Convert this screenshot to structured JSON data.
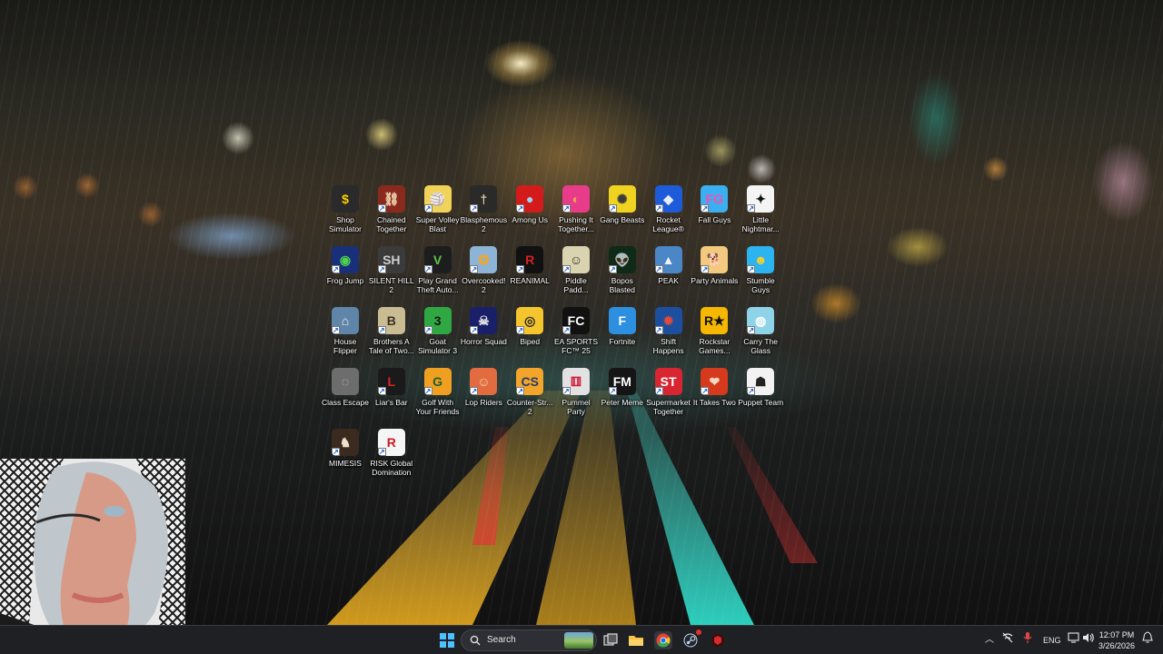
{
  "desktop": {
    "icons": [
      {
        "label": "Shop Simulator",
        "glyph": "$",
        "bg": "#2a2a2a",
        "fg": "#ffd000",
        "shortcut": false
      },
      {
        "label": "Chained Together",
        "glyph": "⛓",
        "bg": "#8a2a1f",
        "fg": "#f1d6b0",
        "shortcut": true
      },
      {
        "label": "Super Volley Blast",
        "glyph": "🏐",
        "bg": "#f2d35a",
        "fg": "#2a5fbf",
        "shortcut": true
      },
      {
        "label": "Blasphemous 2",
        "glyph": "†",
        "bg": "#2a2a28",
        "fg": "#d8cfa6",
        "shortcut": true
      },
      {
        "label": "Among Us",
        "glyph": "●",
        "bg": "#d31b1b",
        "fg": "#9ad5f5",
        "shortcut": true
      },
      {
        "label": "Pushing It Together...",
        "glyph": "◐",
        "bg": "#e83c8a",
        "fg": "#f6a24a",
        "shortcut": true
      },
      {
        "label": "Gang Beasts",
        "glyph": "✺",
        "bg": "#f0d320",
        "fg": "#3a3a3a",
        "shortcut": true
      },
      {
        "label": "Rocket League®",
        "glyph": "◆",
        "bg": "#1e5bd8",
        "fg": "#e8eef8",
        "shortcut": true
      },
      {
        "label": "Fall Guys",
        "glyph": "FG",
        "bg": "#3ab0f0",
        "fg": "#ff4ab0",
        "shortcut": true
      },
      {
        "label": "Little Nightmar...",
        "glyph": "✦",
        "bg": "#f4f4f4",
        "fg": "#111111",
        "shortcut": true
      },
      {
        "label": "Frog Jump",
        "glyph": "◉",
        "bg": "#1a2f7a",
        "fg": "#4cd34c",
        "shortcut": true
      },
      {
        "label": "SILENT HILL 2",
        "glyph": "SH",
        "bg": "#3b3b3b",
        "fg": "#cfcfcf",
        "shortcut": true
      },
      {
        "label": "Play Grand Theft Auto...",
        "glyph": "V",
        "bg": "#1d1d1d",
        "fg": "#5fc24b",
        "shortcut": true
      },
      {
        "label": "Overcooked! 2",
        "glyph": "✪",
        "bg": "#8db3d6",
        "fg": "#f5a623",
        "shortcut": true
      },
      {
        "label": "REANIMAL",
        "glyph": "R",
        "bg": "#111111",
        "fg": "#d82020",
        "shortcut": true
      },
      {
        "label": "Piddle Padd...",
        "glyph": "☺",
        "bg": "#d9d3b0",
        "fg": "#3a2f22",
        "shortcut": true
      },
      {
        "label": "Bopos Blasted",
        "glyph": "👽",
        "bg": "#0f2a17",
        "fg": "#56d24a",
        "shortcut": true
      },
      {
        "label": "PEAK",
        "glyph": "▲",
        "bg": "#4b86c6",
        "fg": "#f1f1f1",
        "shortcut": true
      },
      {
        "label": "Party Animals",
        "glyph": "🐕",
        "bg": "#f2c97e",
        "fg": "#b4632a",
        "shortcut": true
      },
      {
        "label": "Stumble Guys",
        "glyph": "☻",
        "bg": "#2bb4f0",
        "fg": "#f8d02a",
        "shortcut": true
      },
      {
        "label": "House Flipper",
        "glyph": "⌂",
        "bg": "#5f86a8",
        "fg": "#f4f4f4",
        "shortcut": true
      },
      {
        "label": "Brothers A Tale of Two...",
        "glyph": "B",
        "bg": "#c9bb92",
        "fg": "#3a3020",
        "shortcut": true
      },
      {
        "label": "Goat Simulator 3",
        "glyph": "3",
        "bg": "#2fa843",
        "fg": "#121212",
        "shortcut": true
      },
      {
        "label": "Horror Squad",
        "glyph": "☠",
        "bg": "#1a1f6a",
        "fg": "#e6e6e6",
        "shortcut": true
      },
      {
        "label": "Biped",
        "glyph": "◎",
        "bg": "#f5c52e",
        "fg": "#2a2a2a",
        "shortcut": true
      },
      {
        "label": "EA SPORTS FC™ 25",
        "glyph": "FC",
        "bg": "#111111",
        "fg": "#ffffff",
        "shortcut": true
      },
      {
        "label": "Fortnite",
        "glyph": "F",
        "bg": "#2c8fe0",
        "fg": "#ffffff",
        "shortcut": false
      },
      {
        "label": "Shift Happens",
        "glyph": "✹",
        "bg": "#1c4f9e",
        "fg": "#e44a3a",
        "shortcut": true
      },
      {
        "label": "Rockstar Games...",
        "glyph": "R★",
        "bg": "#f5b700",
        "fg": "#111111",
        "shortcut": false
      },
      {
        "label": "Carry The Glass",
        "glyph": "◍",
        "bg": "#8ed3e8",
        "fg": "#ffffff",
        "shortcut": true
      },
      {
        "label": "Class Escape",
        "glyph": "◌",
        "bg": "#6d6d6d",
        "fg": "#d0d0d0",
        "shortcut": false
      },
      {
        "label": "Liar's Bar",
        "glyph": "L",
        "bg": "#1a1a1a",
        "fg": "#d82424",
        "shortcut": true
      },
      {
        "label": "Golf With Your Friends",
        "glyph": "G",
        "bg": "#f0a020",
        "fg": "#1f5e2e",
        "shortcut": true
      },
      {
        "label": "Lop Riders",
        "glyph": "☺",
        "bg": "#e26b3f",
        "fg": "#f7d9a6",
        "shortcut": true
      },
      {
        "label": "Counter-Str... 2",
        "glyph": "CS",
        "bg": "#f2a52a",
        "fg": "#223a6a",
        "shortcut": true
      },
      {
        "label": "Pummel Party",
        "glyph": "⚅",
        "bg": "#e2e2e2",
        "fg": "#d21f3a",
        "shortcut": true
      },
      {
        "label": "Peter Meme",
        "glyph": "FM",
        "bg": "#151515",
        "fg": "#ffffff",
        "shortcut": true
      },
      {
        "label": "Supermarket Together",
        "glyph": "ST",
        "bg": "#d72631",
        "fg": "#ffffff",
        "shortcut": true
      },
      {
        "label": "It Takes Two",
        "glyph": "❤",
        "bg": "#d63a1d",
        "fg": "#f7d6c2",
        "shortcut": true
      },
      {
        "label": "Puppet Team",
        "glyph": "☗",
        "bg": "#f2f2f2",
        "fg": "#222222",
        "shortcut": true
      },
      {
        "label": "MIMESIS",
        "glyph": "♞",
        "bg": "#3a2a20",
        "fg": "#f0e0c8",
        "shortcut": true
      },
      {
        "label": "RISK Global Domination",
        "glyph": "R",
        "bg": "#f5f5f5",
        "fg": "#c81d25",
        "shortcut": true
      }
    ]
  },
  "taskbar": {
    "search_placeholder": "Search",
    "pinned": [
      {
        "name": "start-button",
        "glyph": "⊞",
        "color": "#4cc2ff"
      },
      {
        "name": "task-view-button",
        "glyph": "❐",
        "color": "#dcdcdc"
      },
      {
        "name": "file-explorer-button",
        "glyph": "▰",
        "color": "#f6c342"
      },
      {
        "name": "chrome-button",
        "glyph": "◉",
        "color": "#e64335"
      },
      {
        "name": "steam-button",
        "glyph": "⚙",
        "color": "#cfd6de"
      },
      {
        "name": "game-app-button",
        "glyph": "◈",
        "color": "#d92a2a"
      }
    ],
    "tray": {
      "language": "ENG",
      "time": "12:07 PM",
      "date": "3/26/2026"
    }
  }
}
